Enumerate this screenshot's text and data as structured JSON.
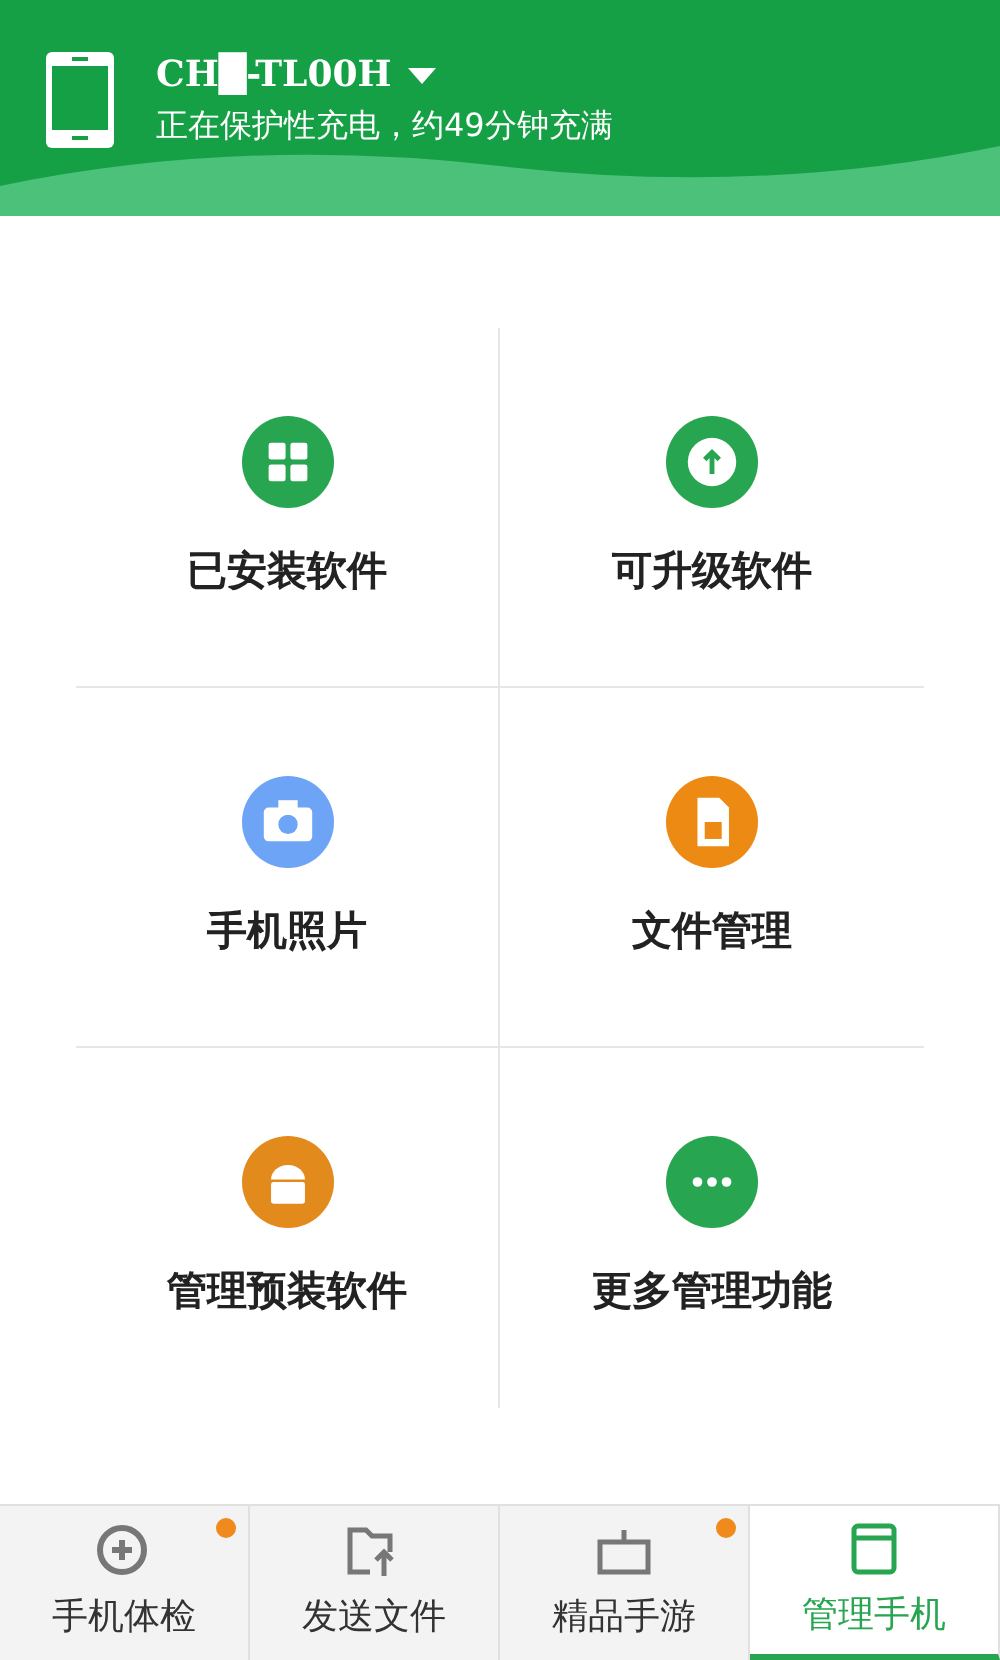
{
  "header": {
    "device_name": "CH█-TL00H",
    "status": "正在保护性充电，约49分钟充满"
  },
  "grid": [
    {
      "label": "已安装软件",
      "kind": "apps",
      "color": "#27a550"
    },
    {
      "label": "可升级软件",
      "kind": "upgrade",
      "color": "#27a550"
    },
    {
      "label": "手机照片",
      "kind": "camera",
      "color": "#6ea4f5"
    },
    {
      "label": "文件管理",
      "kind": "sdcard",
      "color": "#ec8a13"
    },
    {
      "label": "管理预装软件",
      "kind": "android",
      "color": "#e38a1c"
    },
    {
      "label": "更多管理功能",
      "kind": "more",
      "color": "#27a550"
    }
  ],
  "tabs": [
    {
      "label": "手机体检",
      "kind": "checkup",
      "selected": false,
      "badge": true
    },
    {
      "label": "发送文件",
      "kind": "send",
      "selected": false,
      "badge": false
    },
    {
      "label": "精品手游",
      "kind": "games",
      "selected": false,
      "badge": true
    },
    {
      "label": "管理手机",
      "kind": "manage",
      "selected": true,
      "badge": false
    }
  ]
}
